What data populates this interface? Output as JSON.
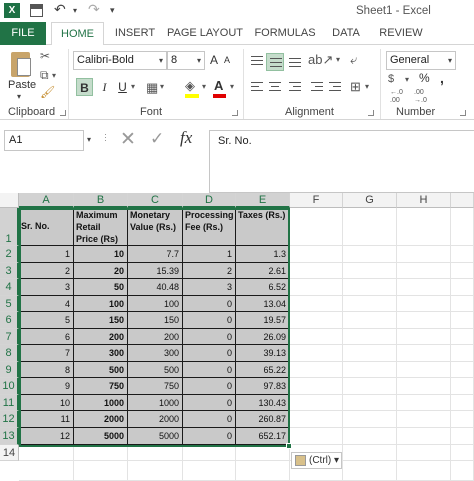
{
  "window": {
    "title": "Sheet1 - Excel",
    "app_logo": "X"
  },
  "tabs": [
    "FILE",
    "HOME",
    "INSERT",
    "PAGE LAYOUT",
    "FORMULAS",
    "DATA",
    "REVIEW"
  ],
  "ribbon": {
    "paste_label": "Paste",
    "clipboard_label": "Clipboard",
    "font_label": "Font",
    "font_name": "Calibri-Bold",
    "font_size": "8",
    "grow_font": "A",
    "shrink_font": "A",
    "bold": "B",
    "italic": "I",
    "underline": "U",
    "alignment_label": "Alignment",
    "number_format": "General",
    "number_label": "Number",
    "currency": "$",
    "percent": "%",
    "comma": ",",
    "inc_decimal": "←.0\n.00",
    "dec_decimal": ".00\n→.0"
  },
  "formula_bar": {
    "name_box": "A1",
    "fx": "fx",
    "value": "Sr. No."
  },
  "columns": [
    "A",
    "B",
    "C",
    "D",
    "E",
    "F",
    "G",
    "H"
  ],
  "rows": [
    "1",
    "2",
    "3",
    "4",
    "5",
    "6",
    "7",
    "8",
    "9",
    "10",
    "11",
    "12",
    "13",
    "14"
  ],
  "headers": {
    "a": "Sr. No.",
    "b": "Maximum Retail Price (Rs)",
    "c": "Monetary Value (Rs.)",
    "d": "Processing Fee (Rs.)",
    "e": "Taxes (Rs.)"
  },
  "table": [
    [
      "1",
      "10",
      "7.7",
      "1",
      "1.3"
    ],
    [
      "2",
      "20",
      "15.39",
      "2",
      "2.61"
    ],
    [
      "3",
      "50",
      "40.48",
      "3",
      "6.52"
    ],
    [
      "4",
      "100",
      "100",
      "0",
      "13.04"
    ],
    [
      "5",
      "150",
      "150",
      "0",
      "19.57"
    ],
    [
      "6",
      "200",
      "200",
      "0",
      "26.09"
    ],
    [
      "7",
      "300",
      "300",
      "0",
      "39.13"
    ],
    [
      "8",
      "500",
      "500",
      "0",
      "65.22"
    ],
    [
      "9",
      "750",
      "750",
      "0",
      "97.83"
    ],
    [
      "10",
      "1000",
      "1000",
      "0",
      "130.43"
    ],
    [
      "11",
      "2000",
      "2000",
      "0",
      "260.87"
    ],
    [
      "12",
      "5000",
      "5000",
      "0",
      "652.17"
    ]
  ],
  "paste_options": {
    "label": "(Ctrl)"
  },
  "colors": {
    "accent": "#217346",
    "selection_fill": "#c9c9c9"
  }
}
